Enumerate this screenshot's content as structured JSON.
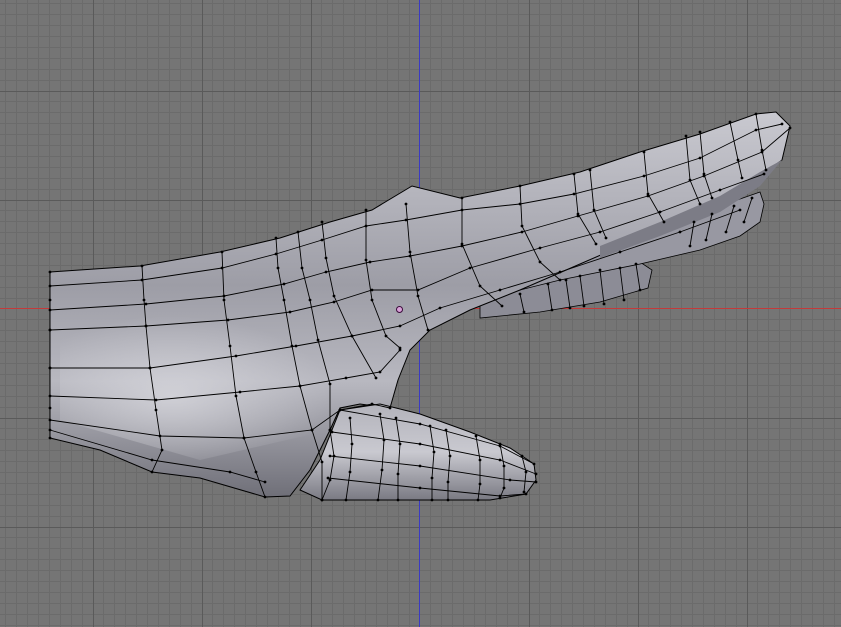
{
  "viewport": {
    "view": "side-orthographic",
    "background_color": "#757575",
    "grid_minor_color": "#6b6b6b",
    "grid_major_color": "#5a5a5a",
    "x_axis_color": "#c43a3a",
    "y_axis_color": "#3a3ac4",
    "grid_visible": true
  },
  "mesh": {
    "object": "hand",
    "display_mode": "solid-with-wireframe",
    "surface_color": "#a6a6b0",
    "wire_color": "#000000",
    "vertex_color": "#000000",
    "pivot_color": "#ff88ff"
  }
}
